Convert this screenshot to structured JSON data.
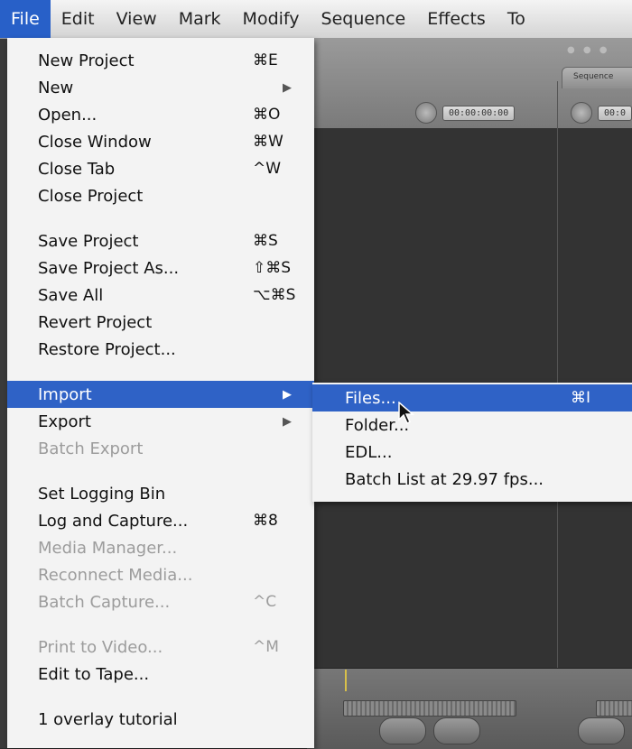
{
  "menubar": {
    "items": [
      {
        "label": "File"
      },
      {
        "label": "Edit"
      },
      {
        "label": "View"
      },
      {
        "label": "Mark"
      },
      {
        "label": "Modify"
      },
      {
        "label": "Sequence"
      },
      {
        "label": "Effects"
      },
      {
        "label": "To"
      }
    ]
  },
  "file_menu": {
    "new_project": {
      "label": "New Project",
      "shortcut": "⌘E"
    },
    "new": {
      "label": "New",
      "arrow": "▶"
    },
    "open": {
      "label": "Open...",
      "shortcut": "⌘O"
    },
    "close_window": {
      "label": "Close Window",
      "shortcut": "⌘W"
    },
    "close_tab": {
      "label": "Close Tab",
      "shortcut": "^W"
    },
    "close_project": {
      "label": "Close Project"
    },
    "save_project": {
      "label": "Save Project",
      "shortcut": "⌘S"
    },
    "save_project_as": {
      "label": "Save Project As...",
      "shortcut": "⇧⌘S"
    },
    "save_all": {
      "label": "Save All",
      "shortcut": "⌥⌘S"
    },
    "revert_project": {
      "label": "Revert Project"
    },
    "restore_project": {
      "label": "Restore Project..."
    },
    "import": {
      "label": "Import",
      "arrow": "▶"
    },
    "export": {
      "label": "Export",
      "arrow": "▶"
    },
    "batch_export": {
      "label": "Batch Export"
    },
    "set_logging_bin": {
      "label": "Set Logging Bin"
    },
    "log_and_capture": {
      "label": "Log and Capture...",
      "shortcut": "⌘8"
    },
    "media_manager": {
      "label": "Media Manager..."
    },
    "reconnect_media": {
      "label": "Reconnect Media..."
    },
    "batch_capture": {
      "label": "Batch Capture...",
      "shortcut": "^C"
    },
    "print_to_video": {
      "label": "Print to Video...",
      "shortcut": "^M"
    },
    "edit_to_tape": {
      "label": "Edit to Tape..."
    },
    "recent_1": {
      "label": "1 overlay tutorial"
    }
  },
  "import_submenu": {
    "files": {
      "label": "Files...",
      "shortcut": "⌘I"
    },
    "folder": {
      "label": "Folder..."
    },
    "edl": {
      "label": "EDL..."
    },
    "batch_list": {
      "label": "Batch List at 29.97 fps..."
    }
  },
  "viewer": {
    "sequence_tab": "Sequence",
    "timecode_1": "00:00:00:00",
    "timecode_2": "00:0"
  },
  "colors": {
    "highlight": "#2f62c6",
    "menubar_active": "#2860c8"
  }
}
